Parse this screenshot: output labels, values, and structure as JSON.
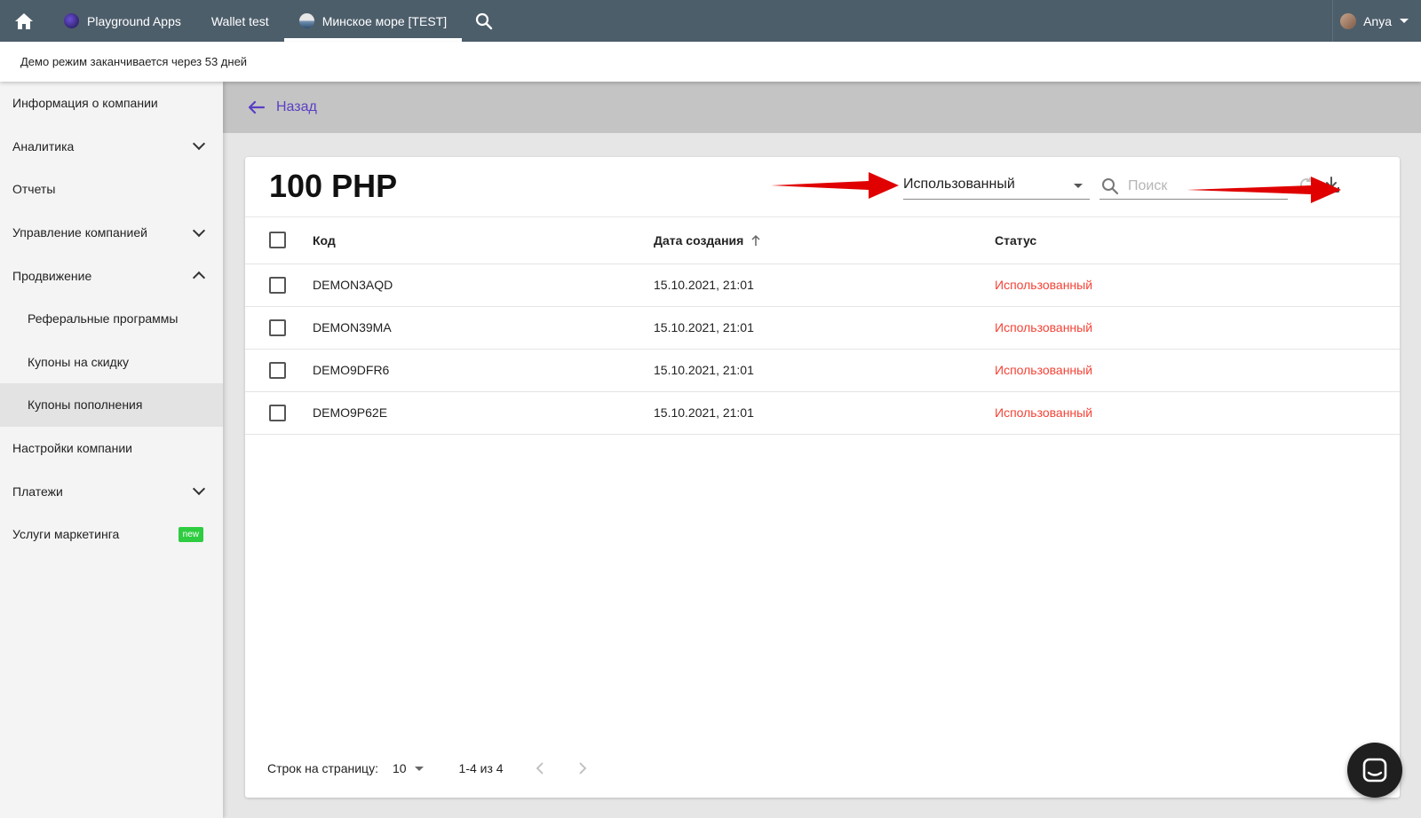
{
  "topbar": {
    "tabs": [
      {
        "label": "Playground Apps",
        "icon": "app-logo-icon",
        "dot_color": "#3b2a8a"
      },
      {
        "label": "Wallet test"
      },
      {
        "label": "Минское море [TEST]",
        "icon": "company-logo-icon",
        "active": true
      }
    ],
    "user": {
      "name": "Anya"
    }
  },
  "demo_banner": {
    "text": "Демо режим заканчивается через 53 дней"
  },
  "sidebar": {
    "items": [
      {
        "label": "Информация о компании"
      },
      {
        "label": "Аналитика",
        "expandable": true
      },
      {
        "label": "Отчеты"
      },
      {
        "label": "Управление компанией",
        "expandable": true
      },
      {
        "label": "Продвижение",
        "expanded": true
      },
      {
        "label": "Реферальные программы",
        "sub": true
      },
      {
        "label": "Купоны на скидку",
        "sub": true
      },
      {
        "label": "Купоны пополнения",
        "sub": true,
        "selected": true
      },
      {
        "label": "Настройки компании"
      },
      {
        "label": "Платежи",
        "expandable": true
      },
      {
        "label": "Услуги маркетинга",
        "badge": "new"
      }
    ]
  },
  "back": {
    "label": "Назад"
  },
  "card": {
    "title": "100 PHP",
    "filter": {
      "value": "Использованный"
    },
    "search": {
      "placeholder": "Поиск"
    },
    "columns": {
      "code": "Код",
      "date": "Дата создания",
      "status": "Статус"
    },
    "rows": [
      {
        "code": "DEMON3AQD",
        "date": "15.10.2021, 21:01",
        "status": "Использованный"
      },
      {
        "code": "DEMON39MA",
        "date": "15.10.2021, 21:01",
        "status": "Использованный"
      },
      {
        "code": "DEMO9DFR6",
        "date": "15.10.2021, 21:01",
        "status": "Использованный"
      },
      {
        "code": "DEMO9P62E",
        "date": "15.10.2021, 21:01",
        "status": "Использованный"
      }
    ],
    "pagination": {
      "rows_label": "Строк на страницу:",
      "rows_value": "10",
      "range": "1-4 из 4"
    }
  },
  "colors": {
    "topbar": "#4d5e6b",
    "accent": "#5b3fc4",
    "status_used": "#f44336",
    "badge_new": "#2ecc40",
    "annotation_arrow": "#e00000"
  }
}
